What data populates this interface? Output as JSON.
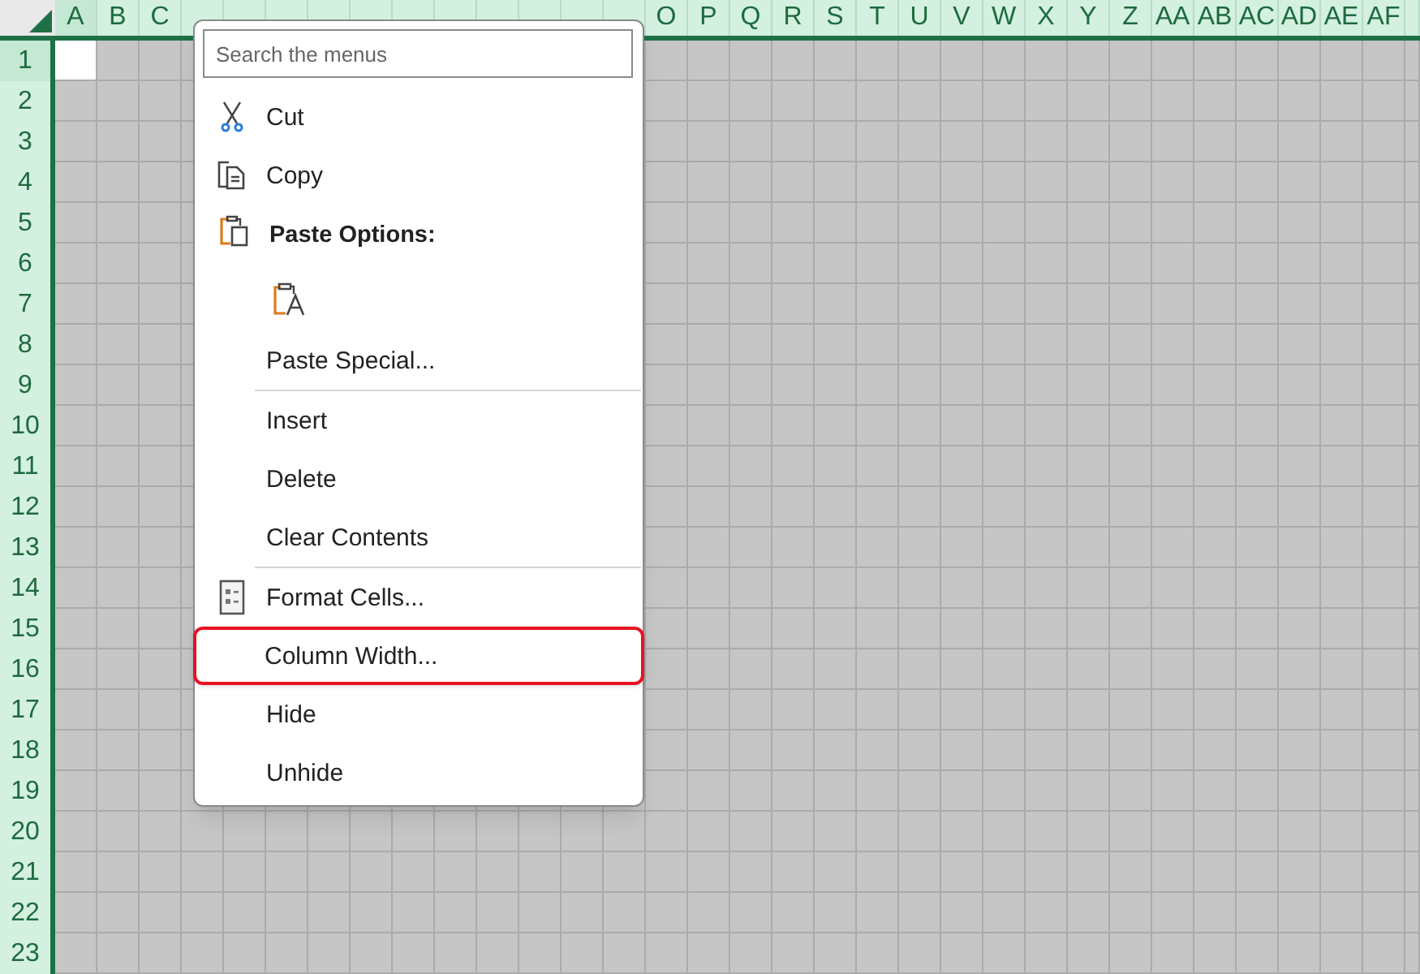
{
  "sheet": {
    "columns": [
      {
        "label": "A",
        "active": true
      },
      {
        "label": "B",
        "active": false
      },
      {
        "label": "C",
        "active": false
      },
      {
        "active": false
      },
      {
        "active": false
      },
      {
        "active": false
      },
      {
        "active": false
      },
      {
        "active": false
      },
      {
        "active": false
      },
      {
        "active": false
      },
      {
        "active": false
      },
      {
        "active": false
      },
      {
        "active": false
      },
      {
        "active": false
      },
      {
        "label": "O",
        "active": false
      },
      {
        "label": "P",
        "active": false
      },
      {
        "label": "Q",
        "active": false
      },
      {
        "label": "R",
        "active": false
      },
      {
        "label": "S",
        "active": false
      },
      {
        "label": "T",
        "active": false
      },
      {
        "label": "U",
        "active": false
      },
      {
        "label": "V",
        "active": false
      },
      {
        "label": "W",
        "active": false
      },
      {
        "label": "X",
        "active": false
      },
      {
        "label": "Y",
        "active": false
      },
      {
        "label": "Z",
        "active": false
      },
      {
        "label": "AA",
        "active": false
      },
      {
        "label": "AB",
        "active": false
      },
      {
        "label": "AC",
        "active": false
      },
      {
        "label": "AD",
        "active": false
      },
      {
        "label": "AE",
        "active": false
      },
      {
        "label": "AF",
        "active": false
      },
      {
        "active": false
      }
    ],
    "rows": [
      {
        "label": "1",
        "active": true
      },
      {
        "label": "2",
        "active": false
      },
      {
        "label": "3",
        "active": false
      },
      {
        "label": "4",
        "active": false
      },
      {
        "label": "5",
        "active": false
      },
      {
        "label": "6",
        "active": false
      },
      {
        "label": "7",
        "active": false
      },
      {
        "label": "8",
        "active": false
      },
      {
        "label": "9",
        "active": false
      },
      {
        "label": "10",
        "active": false
      },
      {
        "label": "11",
        "active": false
      },
      {
        "label": "12",
        "active": false
      },
      {
        "label": "13",
        "active": false
      },
      {
        "label": "14",
        "active": false
      },
      {
        "label": "15",
        "active": false
      },
      {
        "label": "16",
        "active": false
      },
      {
        "label": "17",
        "active": false
      },
      {
        "label": "18",
        "active": false
      },
      {
        "label": "19",
        "active": false
      },
      {
        "label": "20",
        "active": false
      },
      {
        "label": "21",
        "active": false
      },
      {
        "label": "22",
        "active": false
      },
      {
        "label": "23",
        "active": false
      }
    ]
  },
  "context_menu": {
    "search": {
      "placeholder": "Search the menus"
    },
    "items": [
      {
        "kind": "command",
        "label": "Cut",
        "highlighted": false
      },
      {
        "kind": "command",
        "label": "Copy",
        "highlighted": false
      },
      {
        "kind": "heading",
        "label": "Paste Options:"
      },
      {
        "kind": "paste_button"
      },
      {
        "kind": "command",
        "label": "Paste Special...",
        "highlighted": false
      },
      {
        "kind": "separator"
      },
      {
        "kind": "command",
        "label": "Insert",
        "highlighted": false
      },
      {
        "kind": "command",
        "label": "Delete",
        "highlighted": false
      },
      {
        "kind": "command",
        "label": "Clear Contents",
        "highlighted": false
      },
      {
        "kind": "separator"
      },
      {
        "kind": "command",
        "label": "Format Cells...",
        "highlighted": false
      },
      {
        "kind": "command",
        "label": "Column Width...",
        "highlighted": true
      },
      {
        "kind": "command",
        "label": "Hide",
        "highlighted": false
      },
      {
        "kind": "command",
        "label": "Unhide",
        "highlighted": false
      }
    ]
  }
}
